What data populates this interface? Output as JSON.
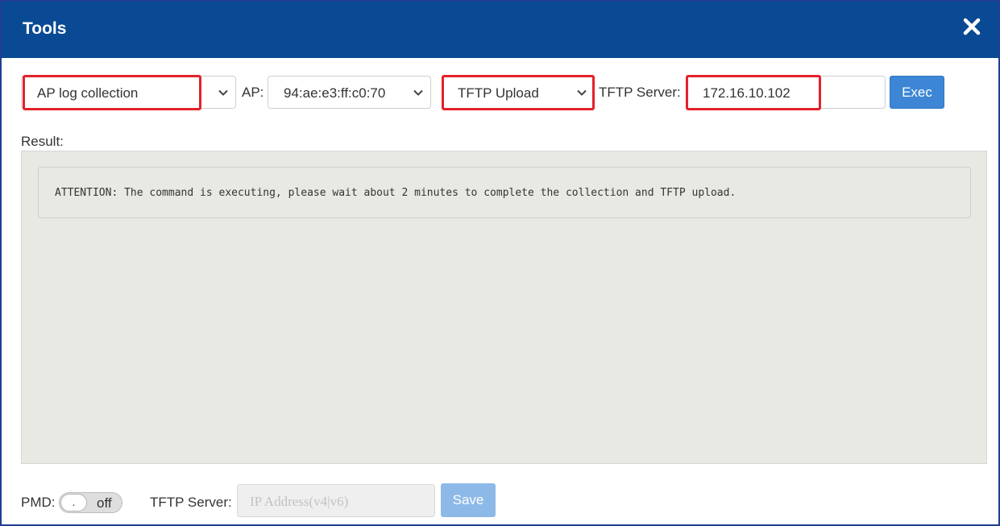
{
  "dialog": {
    "title": "Tools",
    "close_icon": "close-icon"
  },
  "toolbar": {
    "tool_select": "AP log collection",
    "ap_label": "AP:",
    "ap_select": "94:ae:e3:ff:c0:70",
    "method_select": "TFTP Upload",
    "tftp_label": "TFTP Server:",
    "tftp_server_value": "172.16.10.102",
    "exec_label": "Exec",
    "highlight_color": "#e3222a"
  },
  "result": {
    "label": "Result:",
    "message": "ATTENTION: The command is executing, please wait about 2 minutes to complete the collection and TFTP upload."
  },
  "footer": {
    "pmd_label": "PMD:",
    "pmd_knob": ".",
    "pmd_state": "off",
    "tftp_label": "TFTP Server:",
    "ip_placeholder": "IP Address(v4|v6)",
    "save_label": "Save"
  },
  "colors": {
    "titlebar": "#0a4a94",
    "button": "#3d86d5",
    "button_disabled": "#8db9e8",
    "result_bg": "#e9e9e4"
  }
}
